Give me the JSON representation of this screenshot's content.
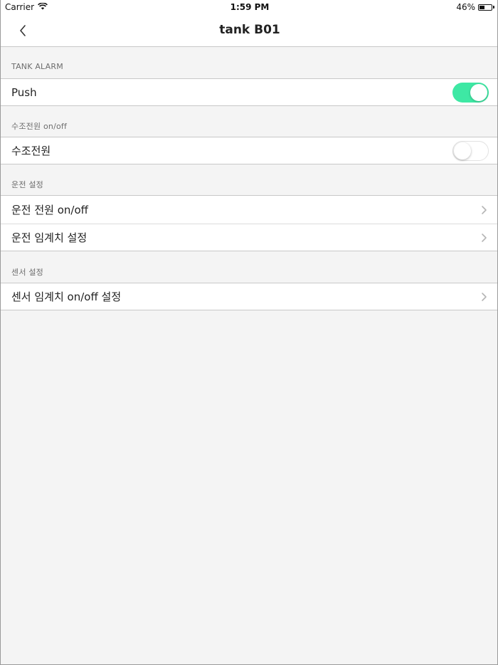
{
  "status_bar": {
    "carrier": "Carrier",
    "time": "1:59 PM",
    "battery_text": "46%",
    "battery_level": 0.46
  },
  "nav": {
    "title": "tank B01"
  },
  "sections": {
    "tank_alarm": {
      "header": "TANK ALARM",
      "push": {
        "label": "Push",
        "toggle_on": true
      }
    },
    "tank_power": {
      "header": "수조전원 on/off",
      "power": {
        "label": "수조전원",
        "toggle_on": false
      }
    },
    "operation": {
      "header": "운전 설정",
      "items": [
        {
          "label": "운전 전원 on/off"
        },
        {
          "label": "운전 임계치 설정"
        }
      ]
    },
    "sensor": {
      "header": "센서 설정",
      "items": [
        {
          "label": "센서 임계치 on/off 설정"
        }
      ]
    }
  },
  "colors": {
    "toggle_on": "#3ee8a4",
    "background": "#f4f4f4"
  }
}
